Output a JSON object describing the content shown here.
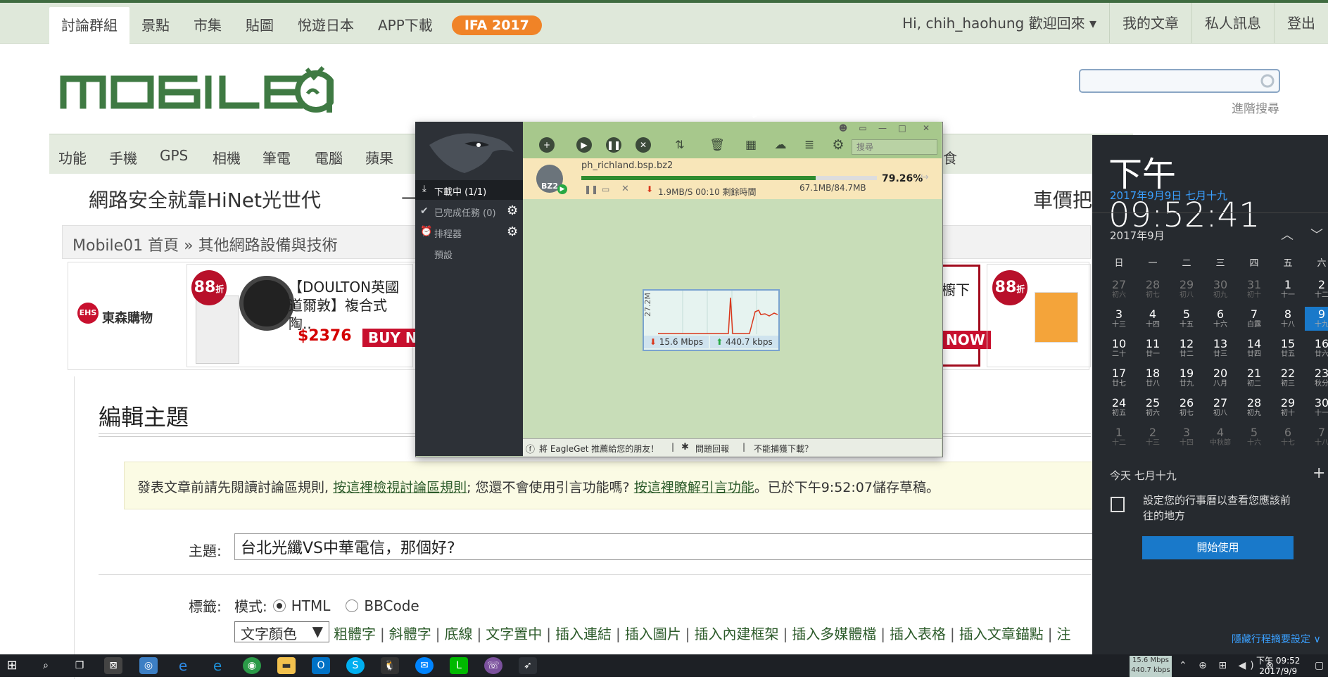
{
  "forum": {
    "nav_tabs": [
      "討論群組",
      "景點",
      "市集",
      "貼圖",
      "悅遊日本",
      "APP下載"
    ],
    "ifa_badge": "IFA 2017",
    "user_greeting": "Hi, chih_haohung 歡迎回來 ▾",
    "user_links": [
      "我的文章",
      "私人訊息",
      "登出"
    ],
    "advanced_search": "進階搜尋",
    "categories": [
      "功能",
      "手機",
      "GPS",
      "相機",
      "筆電",
      "電腦",
      "蘋果",
      "遊美食"
    ],
    "banner_left": "網路安全就靠HiNet光世代",
    "banner_right": "車價把",
    "breadcrumb": "Mobile01 首頁 » 其他網路設備與技術",
    "ads": {
      "ehs_logo": "EHS",
      "ehs_name": "東森購物",
      "badge": "88",
      "badge_unit": "折",
      "product_title": "【DOULTON英國道爾敦】複合式陶..",
      "product_price": "$2376",
      "buy_now": "BUY NOW",
      "product2_title_tail": "櫥下",
      "buy_now2": "NOW"
    },
    "edit": {
      "title": "編輯主題",
      "notice_pre": "發表文章前請先閱讀討論區規則,",
      "notice_link1": "按這裡檢視討論區規則",
      "notice_mid": "; 您還不會使用引言功能嗎?",
      "notice_link2": "按這裡瞭解引言功能",
      "notice_post": "。已於下午9:52:07儲存草稿。",
      "subject_label": "主題:",
      "subject_value": "台北光纖VS中華電信，那個好?",
      "tags_label": "標籤:",
      "mode_label": "模式:",
      "mode_html": "HTML",
      "mode_bbcode": "BBCode",
      "color_select": "文字顏色",
      "toolbar_links": [
        "粗體字",
        "斜體字",
        "底線",
        "文字置中",
        "插入連結",
        "插入圖片",
        "插入內建框架",
        "插入多媒體檔",
        "插入表格",
        "插入文章錨點",
        "注"
      ]
    }
  },
  "eagleget": {
    "sidebar": {
      "downloading": "下載中 (1/1)",
      "completed": "已完成任務 (0)",
      "scheduler": "排程器",
      "preset": "預設"
    },
    "search_placeholder": "搜尋",
    "file_name": "ph_richland.bsp.bz2",
    "file_icon_label": "BZ2",
    "progress_percent": 79.26,
    "progress_text": "79.26%",
    "speed_text": "1.9MB/S 00:10 剩餘時間",
    "size_text": "67.1MB/84.7MB",
    "graph_label": "27.2M",
    "graph_down": "15.6 Mbps",
    "graph_up": "440.7 kbps",
    "bottom_links": [
      "將 EagleGet 推薦給您的朋友！",
      "問題回報",
      "不能捕獲下載？"
    ]
  },
  "clock": {
    "time": "下午 09:52:41",
    "date": "2017年9月9日 七月十九",
    "month": "2017年9月",
    "weekdays": [
      "日",
      "一",
      "二",
      "三",
      "四",
      "五",
      "六"
    ],
    "weeks": [
      [
        [
          "27",
          "初六"
        ],
        [
          "28",
          "初七"
        ],
        [
          "29",
          "初八"
        ],
        [
          "30",
          "初九"
        ],
        [
          "31",
          "初十"
        ],
        [
          "1",
          "十一"
        ],
        [
          "2",
          "十二"
        ]
      ],
      [
        [
          "3",
          "十三"
        ],
        [
          "4",
          "十四"
        ],
        [
          "5",
          "十五"
        ],
        [
          "6",
          "十六"
        ],
        [
          "7",
          "白露"
        ],
        [
          "8",
          "十八"
        ],
        [
          "9",
          "十九"
        ]
      ],
      [
        [
          "10",
          "二十"
        ],
        [
          "11",
          "廿一"
        ],
        [
          "12",
          "廿二"
        ],
        [
          "13",
          "廿三"
        ],
        [
          "14",
          "廿四"
        ],
        [
          "15",
          "廿五"
        ],
        [
          "16",
          "廿六"
        ]
      ],
      [
        [
          "17",
          "廿七"
        ],
        [
          "18",
          "廿八"
        ],
        [
          "19",
          "廿九"
        ],
        [
          "20",
          "八月"
        ],
        [
          "21",
          "初二"
        ],
        [
          "22",
          "初三"
        ],
        [
          "23",
          "秋分"
        ]
      ],
      [
        [
          "24",
          "初五"
        ],
        [
          "25",
          "初六"
        ],
        [
          "26",
          "初七"
        ],
        [
          "27",
          "初八"
        ],
        [
          "28",
          "初九"
        ],
        [
          "29",
          "初十"
        ],
        [
          "30",
          "十一"
        ]
      ],
      [
        [
          "1",
          "十二"
        ],
        [
          "2",
          "十三"
        ],
        [
          "3",
          "十四"
        ],
        [
          "4",
          "中秋節"
        ],
        [
          "5",
          "十六"
        ],
        [
          "6",
          "十七"
        ],
        [
          "7",
          "十八"
        ]
      ]
    ],
    "today_label": "今天 七月十九",
    "calendar_msg": "設定您的行事曆以查看您應該前往的地方",
    "start_button": "開始使用",
    "hide_agenda": "隱藏行程摘要設定 ∨"
  },
  "taskbar": {
    "net_down": "15.6 Mbps",
    "net_up": "440.7 kbps",
    "time": "下午 09:52",
    "date": "2017/9/9"
  }
}
